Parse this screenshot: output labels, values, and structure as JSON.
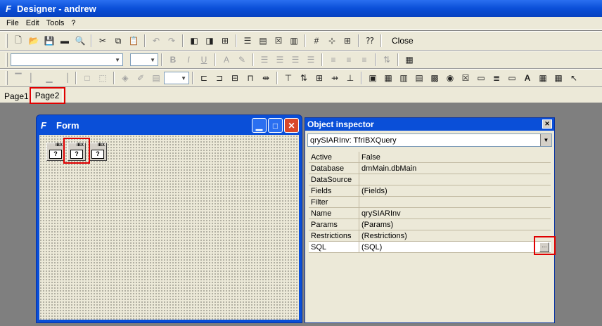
{
  "window": {
    "title": "Designer - andrew"
  },
  "menu": {
    "items": [
      "File",
      "Edit",
      "Tools",
      "?"
    ]
  },
  "toolbar": {
    "close_label": "Close"
  },
  "tabs": [
    {
      "label": "Page1"
    },
    {
      "label": "Page2"
    }
  ],
  "form": {
    "title": "Form",
    "components": [
      {
        "tag": "IBX"
      },
      {
        "tag": "IBX"
      },
      {
        "tag": "IBX"
      }
    ]
  },
  "inspector": {
    "title": "Object inspector",
    "selected_object": "qrySIARInv: TfrIBXQuery",
    "properties": [
      {
        "name": "Active",
        "value": "False"
      },
      {
        "name": "Database",
        "value": "dmMain.dbMain"
      },
      {
        "name": "DataSource",
        "value": ""
      },
      {
        "name": "Fields",
        "value": "(Fields)"
      },
      {
        "name": "Filter",
        "value": ""
      },
      {
        "name": "Name",
        "value": "qrySIARInv"
      },
      {
        "name": "Params",
        "value": "(Params)"
      },
      {
        "name": "Restrictions",
        "value": "(Restrictions)"
      },
      {
        "name": "SQL",
        "value": "(SQL)"
      }
    ],
    "ellipsis_label": "..."
  },
  "colors": {
    "title_blue": "#0a4fd8",
    "highlight_red": "#e00000",
    "face": "#ece9d8"
  }
}
